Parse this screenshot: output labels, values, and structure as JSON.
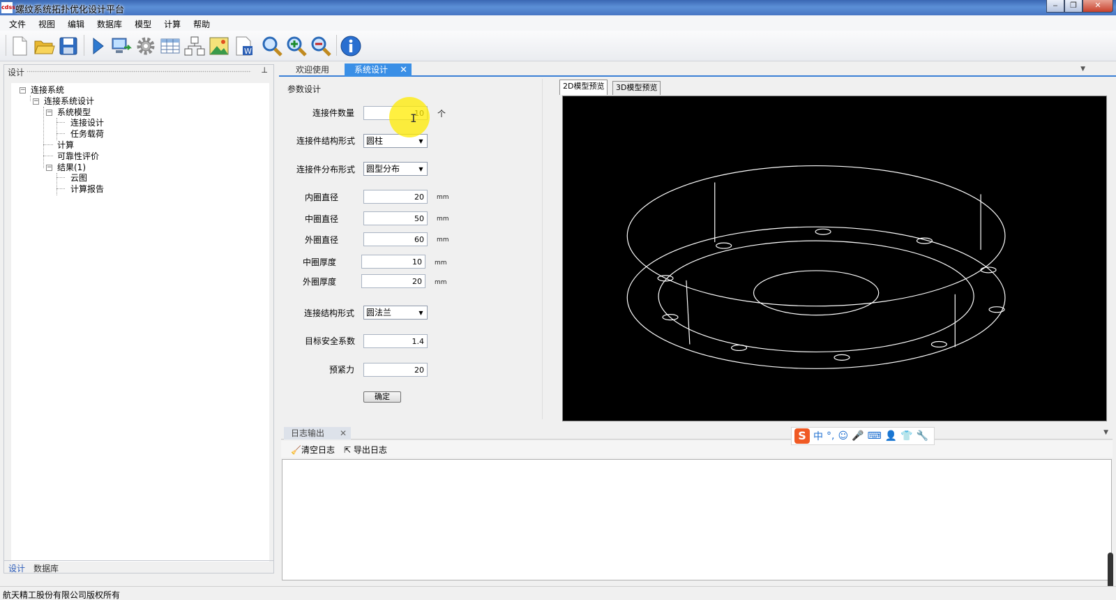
{
  "window": {
    "title": "螺纹系统拓扑优化设计平台",
    "icon_label": "cdss"
  },
  "menu": [
    "文件",
    "视图",
    "编辑",
    "数据库",
    "模型",
    "计算",
    "帮助"
  ],
  "toolbar_icons": [
    "new-file-icon",
    "open-folder-icon",
    "save-icon",
    "run-icon",
    "computer-export-icon",
    "gear-icon",
    "table-icon",
    "tree-chart-icon",
    "image-icon",
    "word-doc-icon",
    "zoom-icon",
    "zoom-in-icon",
    "zoom-out-icon",
    "info-icon"
  ],
  "left_panel": {
    "header": "设计",
    "pin_glyph": "ᚬ",
    "tree": [
      {
        "label": "连接系统",
        "level": 0,
        "toggle": "−"
      },
      {
        "label": "连接系统设计",
        "level": 1,
        "toggle": "−"
      },
      {
        "label": "系统模型",
        "level": 2,
        "toggle": "−"
      },
      {
        "label": "连接设计",
        "level": 3
      },
      {
        "label": "任务载荷",
        "level": 3
      },
      {
        "label": "计算",
        "level": 2
      },
      {
        "label": "可靠性评价",
        "level": 2
      },
      {
        "label": "结果(1)",
        "level": 2,
        "toggle": "−"
      },
      {
        "label": "云图",
        "level": 3
      },
      {
        "label": "计算报告",
        "level": 3
      }
    ],
    "tabs": [
      "设计",
      "数据库"
    ]
  },
  "doc_tabs": {
    "welcome": "欢迎使用",
    "active": "系统设计",
    "close_glyph": "✕",
    "dropdown_glyph": "▼"
  },
  "params": {
    "group_title": "参数设计",
    "connector_count": {
      "label": "连接件数量",
      "value": "10",
      "unit": "个"
    },
    "structure_form": {
      "label": "连接件结构形式",
      "value": "圆柱"
    },
    "distribution_form": {
      "label": "连接件分布形式",
      "value": "圆型分布"
    },
    "inner_diameter": {
      "label": "内圈直径",
      "value": "20",
      "unit": "mm"
    },
    "middle_diameter": {
      "label": "中圈直径",
      "value": "50",
      "unit": "mm"
    },
    "outer_diameter": {
      "label": "外圈直径",
      "value": "60",
      "unit": "mm"
    },
    "middle_thickness": {
      "label": "中圈厚度",
      "value": "10",
      "unit": "mm"
    },
    "outer_thickness": {
      "label": "外圈厚度",
      "value": "20",
      "unit": "mm"
    },
    "connection_form": {
      "label": "连接结构形式",
      "value": "圆法兰"
    },
    "safety_factor": {
      "label": "目标安全系数",
      "value": "1.4"
    },
    "preload": {
      "label": "预紧力",
      "value": "20"
    },
    "confirm": "确定",
    "dropdown_glyph": "▼",
    "cursor_glyph": "I"
  },
  "preview": {
    "tab_2d": "2D模型预览",
    "tab_3d": "3D模型预览",
    "line_color": "#ffffff",
    "background": "#000000"
  },
  "log": {
    "tab": "日志输出",
    "close_glyph": "✕",
    "dropdown_glyph": "▼",
    "clear": "清空日志",
    "export": "导出日志",
    "ime": {
      "logo": "S",
      "lang": "中",
      "punct": "°,",
      "items": [
        "☺",
        "🎤",
        "⌨",
        "👤",
        "👕",
        "🔧"
      ]
    }
  },
  "status": {
    "text": "航天精工股份有限公司版权所有"
  }
}
